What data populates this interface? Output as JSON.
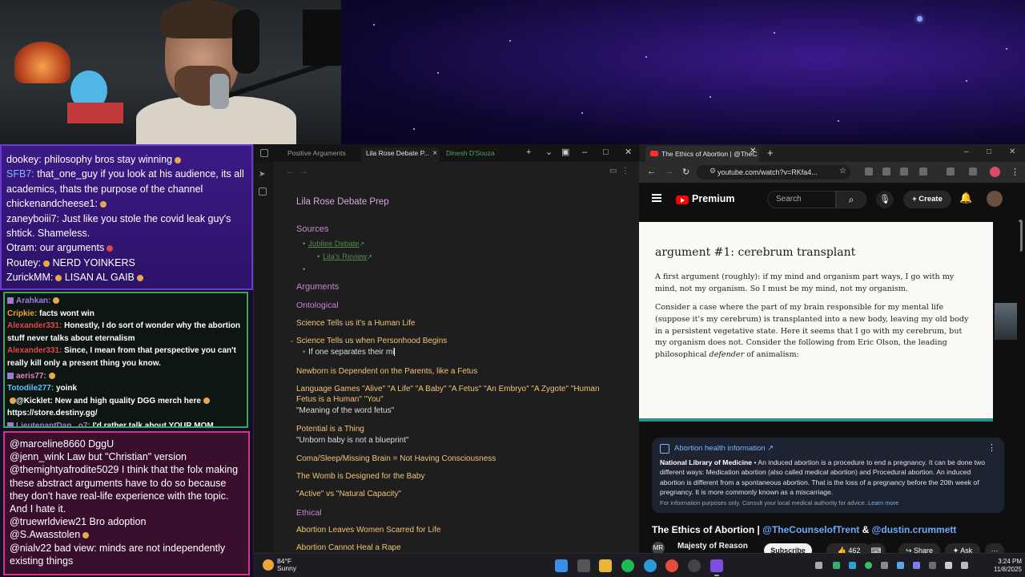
{
  "chat": {
    "top": [
      {
        "nick": "dookey:",
        "text": "philosophy bros stay winning"
      },
      {
        "nick": "SFB7:",
        "text": "that_one_guy if you look at his audience, its all"
      },
      {
        "nick": "",
        "text": "academics, thats the purpose of the channel"
      },
      {
        "nick": "chickenandcheese1:",
        "text": ""
      },
      {
        "nick": "zaneyboiii7:",
        "text": "Just like you stole the covid leak guy's"
      },
      {
        "nick": "",
        "text": "shtick. Shameless."
      },
      {
        "nick": "Otram:",
        "text": "our arguments"
      },
      {
        "nick": "Routey:",
        "text": "NERD YOINKERS"
      },
      {
        "nick": "ZurickMM:",
        "text": "LISAN AL GAIB"
      }
    ],
    "mid": [
      {
        "nick": "Arahkan:",
        "text": "",
        "color": "#9f7bea"
      },
      {
        "nick": "Cripkie:",
        "text": "facts wont win",
        "color": "#f0a040"
      },
      {
        "nick": "Alexander331:",
        "text": "Honestly, I do sort of wonder why the abortion",
        "color": "#e04848"
      },
      {
        "nick": "",
        "text": "stuff never talks about eternalism",
        "color": "#e04848"
      },
      {
        "nick": "Alexander331:",
        "text": "Since, I mean from that perspective you can't",
        "color": "#e04848"
      },
      {
        "nick": "",
        "text": "really kill only a present thing you know.",
        "color": "#e04848"
      },
      {
        "nick": "aeris77:",
        "text": "",
        "color": "#e87fb8"
      },
      {
        "nick": "Totodile277:",
        "text": "yoink",
        "color": "#59c3ff"
      },
      {
        "nick": "@Kicklet:",
        "text": "New and high quality DGG merch here",
        "color": "#ffffff"
      },
      {
        "nick": "",
        "text": "https://store.destiny.gg/",
        "color": "#ffffff"
      },
      {
        "nick": "LieutenantDan_ o7:",
        "text": "I'd rather talk about YOUR MOM",
        "color": "#9f7bea"
      }
    ],
    "bottom": [
      "@marceline8660 DggU",
      "@jenn_wink Law but \"Christian\" version",
      "@themightyafrodite5029 I think that the folx making these abstract arguments have to do so because they don't have real-life experience with the topic. And I hate it.",
      "@truewrldview21 Bro adoption",
      "@S.Awasstolen",
      "@nialv22 bad view: minds are not independently existing things"
    ]
  },
  "obsidian": {
    "tabs": [
      "Positive Arguments",
      "Lila Rose Debate P...",
      "Dinesh D'Souza"
    ],
    "note": {
      "title": "Lila Rose Debate Prep",
      "sources_heading": "Sources",
      "source_links": [
        "Jubilee Debate",
        "Lila's Review"
      ],
      "arguments_heading": "Arguments",
      "ontological_heading": "Ontological",
      "items": [
        "Science Tells us it's a Human Life",
        "Science Tells us when Personhood Begins",
        "If one separates their mi",
        "Newborn is Dependent on the Parents, like a Fetus",
        "Language Games \"Alive\" \"A Life\" \"A Baby\" \"A Fetus\" \"An Embryo\" \"A Zygote\" \"Human",
        "Fetus is a Human\" \"You\"",
        "\"Meaning of the word fetus\"",
        "Potential is a Thing",
        "\"Unborn baby is not a blueprint\"",
        "Coma/Sleep/Missing Brain = Not Having Consciousness",
        "The Womb is Designed for the Baby",
        "\"Active\" vs \"Natural Capacity\""
      ],
      "ethical_heading": "Ethical",
      "ethical_items": [
        "Abortion Leaves Women Scarred for Life",
        "Abortion Cannot Heal a Rape"
      ]
    }
  },
  "browser": {
    "tab_title": "The Ethics of Abortion | @TheC",
    "url": "youtube.com/watch?v=RKfa4...",
    "brand": "Premium",
    "search_placeholder": "Search",
    "create_label": "Create",
    "slide": {
      "title": "argument #1: cerebrum transplant",
      "p1": "A first argument (roughly): if my mind and organism part ways, I go with my mind, not my organism. So I must be my mind, not my organism.",
      "p2a": "Consider a case where the part of my brain responsible for my mental life (suppose it's my cerebrum) is transplanted into a new body, leaving my old body in a persistent vegetative state. Here it seems that I go with my cerebrum, but my organism does not. Consider the following from Eric Olson, the leading philosophical",
      "p2_italic": "defender",
      "p2b": "of animalism:"
    },
    "info": {
      "heading": "Abortion health information",
      "source": "National Library of Medicine",
      "body": "An induced abortion is a procedure to end a pregnancy. It can be done two different ways: Medication abortion (also called medical abortion) and Procedural abortion. An induced abortion is different from a spontaneous abortion. That is the loss of a pregnancy before the 20th week of pregnancy. It is more commonly known as a miscarriage.",
      "foot": "For information purposes only. Consult your local medical authority for advice.",
      "learn_more": "Learn more"
    },
    "video_title": "The Ethics of Abortion |",
    "title_handle1": "@TheCounselofTrent",
    "title_amp": "&",
    "title_handle2": "@dustin.crummett",
    "channel_initials": "MR",
    "channel": "Majesty of Reason",
    "subscribe": "Subscribe",
    "likes": "462",
    "share": "Share",
    "ask": "Ask"
  },
  "taskbar": {
    "temp": "84°F",
    "weather": "Sunny",
    "time": "3:24 PM",
    "date": "11/8/2025"
  }
}
